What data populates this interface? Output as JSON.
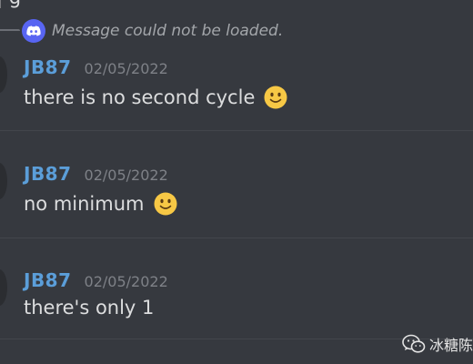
{
  "top_fragment": "| g",
  "reply": {
    "text": "Message could not be loaded.",
    "icon": "discord-logo-icon"
  },
  "messages": [
    {
      "author": "JB87",
      "timestamp": "02/05/2022",
      "text": "there is no second cycle",
      "emoji": "slightly-smiling-face-icon"
    },
    {
      "author": "JB87",
      "timestamp": "02/05/2022",
      "text": "no minimum",
      "emoji": "slightly-smiling-face-icon"
    },
    {
      "author": "JB87",
      "timestamp": "02/05/2022",
      "text": "there's only 1",
      "emoji": null
    }
  ],
  "watermark": {
    "text": "冰糖陈",
    "icon": "wechat-icon"
  },
  "colors": {
    "background": "#36393f",
    "author": "#5b9ed9",
    "timestamp": "#7e8187",
    "text": "#dcddde",
    "reply_text": "#a3a6aa",
    "discord_blurple": "#5865f2"
  }
}
